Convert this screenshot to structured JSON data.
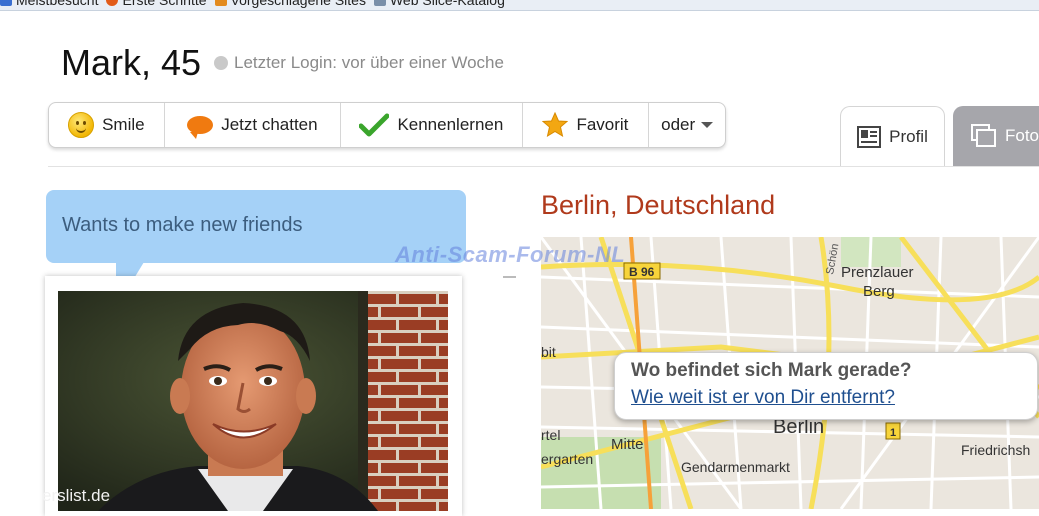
{
  "favorites_bar": {
    "items": [
      {
        "label": "Meistbesucht",
        "icon": "ie-page-icon",
        "color": "#3a6fd0"
      },
      {
        "label": "Erste Schritte",
        "icon": "firefox-icon",
        "color": "#e25b18"
      },
      {
        "label": "Vorgeschlagene Sites",
        "icon": "suggested-sites-icon",
        "color": "#e38b1e"
      },
      {
        "label": "Web Slice-Katalog",
        "icon": "web-slice-icon",
        "color": "#7a8fa8"
      }
    ]
  },
  "profile": {
    "name_age": "Mark, 45",
    "status_color": "#c9c9c9",
    "last_login": "Letzter Login: vor über einer Woche"
  },
  "actions": [
    {
      "label": "Smile",
      "icon": "smiley-icon"
    },
    {
      "label": "Jetzt chatten",
      "icon": "chat-bubble-icon"
    },
    {
      "label": "Kennenlernen",
      "icon": "checkmark-icon"
    },
    {
      "label": "Favorit",
      "icon": "star-icon"
    },
    {
      "label": "oder",
      "icon": "chevron-down-icon"
    }
  ],
  "tabs": [
    {
      "label": "Profil",
      "icon": "profile-card-icon",
      "active": true
    },
    {
      "label": "Fotos",
      "icon": "photos-icon",
      "active": false
    }
  ],
  "bubble": {
    "text": "Wants to make new friends",
    "color": "#a5d1f7"
  },
  "photo": {
    "watermark": "erslist.de"
  },
  "location": {
    "title": "Berlin, Deutschland",
    "title_color": "#b03a1c"
  },
  "map": {
    "labels": {
      "road_b96": "B 96",
      "prenzlauer": "Prenzlauer",
      "berg": "Berg",
      "schon": "Schön",
      "bit": "bit",
      "rtel": "rtel",
      "mitte": "Mitte",
      "ergarten": "ergarten",
      "berlin": "Berlin",
      "road_1": "1",
      "gendarmenmarkt": "Gendarmenmarkt",
      "friedrichs": "Friedrichsh"
    },
    "popup_title": "Wo befindet sich Mark gerade?",
    "popup_link": "Wie weit ist er von Dir entfernt?"
  },
  "watermark": {
    "text": "Anti-Scam-Forum-NL"
  }
}
